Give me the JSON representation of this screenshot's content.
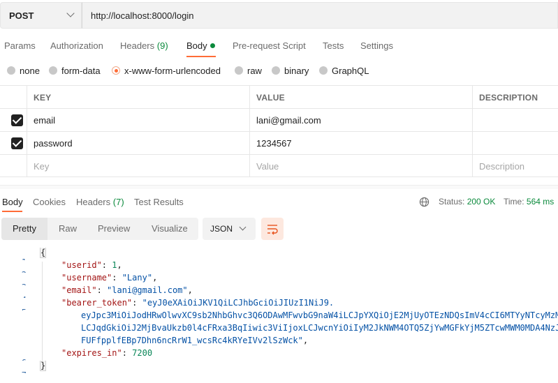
{
  "request": {
    "method": "POST",
    "url": "http://localhost:8000/login"
  },
  "request_tabs": [
    {
      "label": "Params"
    },
    {
      "label": "Authorization"
    },
    {
      "label": "Headers",
      "count": "(9)"
    },
    {
      "label": "Body"
    },
    {
      "label": "Pre-request Script"
    },
    {
      "label": "Tests"
    },
    {
      "label": "Settings"
    }
  ],
  "body_types": [
    {
      "label": "none"
    },
    {
      "label": "form-data"
    },
    {
      "label": "x-www-form-urlencoded",
      "selected": true
    },
    {
      "label": "raw"
    },
    {
      "label": "binary"
    },
    {
      "label": "GraphQL"
    }
  ],
  "params_table": {
    "headers": [
      "KEY",
      "VALUE",
      "DESCRIPTION"
    ],
    "rows": [
      {
        "key": "email",
        "value": "lani@gmail.com",
        "description": "",
        "checked": true
      },
      {
        "key": "password",
        "value": "1234567",
        "description": "",
        "checked": true
      }
    ],
    "placeholder": {
      "key": "Key",
      "value": "Value",
      "description": "Description"
    }
  },
  "response_tabs": [
    {
      "label": "Body"
    },
    {
      "label": "Cookies"
    },
    {
      "label": "Headers",
      "count": "(7)"
    },
    {
      "label": "Test Results"
    }
  ],
  "status": {
    "status_label": "Status:",
    "status_value": "200 OK",
    "time_label": "Time:",
    "time_value": "564 ms"
  },
  "viewer": {
    "modes": [
      "Pretty",
      "Raw",
      "Preview",
      "Visualize"
    ],
    "format": "JSON"
  },
  "code_lines": {
    "l1": {
      "n": "1",
      "text": "{"
    },
    "l2": {
      "n": "2",
      "key": "\"userid\"",
      "sep": ": ",
      "val": "1",
      "end": ","
    },
    "l3": {
      "n": "3",
      "key": "\"username\"",
      "sep": ": ",
      "val": "\"Lany\"",
      "end": ","
    },
    "l4": {
      "n": "4",
      "key": "\"email\"",
      "sep": ": ",
      "val": "\"lani@gmail.com\"",
      "end": ","
    },
    "l5": {
      "n": "5",
      "key": "\"bearer_token\"",
      "sep": ": ",
      "val": "\"eyJ0eXAiOiJKV1QiLCJhbGciOiJIUzI1NiJ9."
    },
    "l5b": {
      "text": "eyJpc3MiOiJodHRwOlwvXC9sb2NhbGhvc3Q6ODAwMFwvbG9naW4iLCJpYXQiOjE2MjUyOTEzNDQsImV4cCI6MTYyNTcyMzM"
    },
    "l5c": {
      "text": "LCJqdGkiOiJ2MjBvaUkzb0l4cFRxa3BqIiwic3ViIjoxLCJwcnYiOiIyM2JkNWM4OTQ5ZjYwMGFkYjM5ZTcwMWM0MDA4NzJ"
    },
    "l5d": {
      "text": "FUFfpplfEBp7Dhn6ncRrW1_wcsRc4kRYeIVv2lSzWck\"",
      "end": ","
    },
    "l6": {
      "n": "6",
      "key": "\"expires_in\"",
      "sep": ": ",
      "val": "7200"
    },
    "l7": {
      "n": "7",
      "text": "}"
    }
  }
}
